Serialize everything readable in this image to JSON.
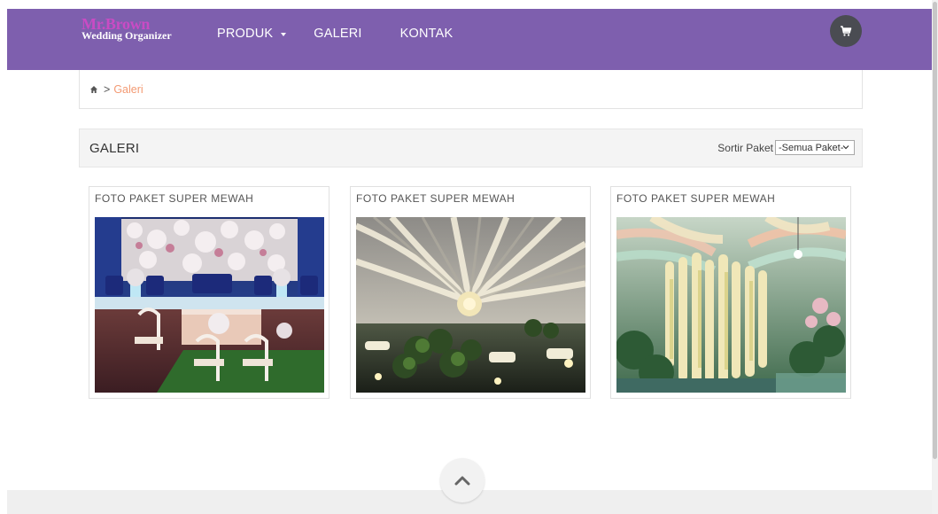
{
  "brand": {
    "name_top": "Mr.Brown",
    "name_bottom": "Wedding Organizer"
  },
  "nav": {
    "items": [
      {
        "label": "PRODUK",
        "has_dropdown": true
      },
      {
        "label": "GALERI",
        "has_dropdown": false
      },
      {
        "label": "KONTAK",
        "has_dropdown": false
      }
    ],
    "cart_icon": "shopping-cart-icon"
  },
  "breadcrumb": {
    "home_icon": "home-icon",
    "separator": ">",
    "current": "Galeri"
  },
  "section": {
    "title": "GALERI",
    "sort_label": "Sortir Paket",
    "sort_selected": "-Semua Paket-"
  },
  "gallery": [
    {
      "title": "FOTO PAKET SUPER MEWAH",
      "image": "wedding-stage-blue-white-photo"
    },
    {
      "title": "FOTO PAKET SUPER MEWAH",
      "image": "draped-tent-ceiling-photo"
    },
    {
      "title": "FOTO PAKET SUPER MEWAH",
      "image": "hanging-flowers-pastel-drapes-photo"
    }
  ],
  "scroll_top_icon": "chevron-up-icon",
  "colors": {
    "navbar": "#7e5fae",
    "brand_accent": "#c94bc4",
    "breadcrumb_current": "#f39a73",
    "cart_button": "#4a4c52"
  }
}
